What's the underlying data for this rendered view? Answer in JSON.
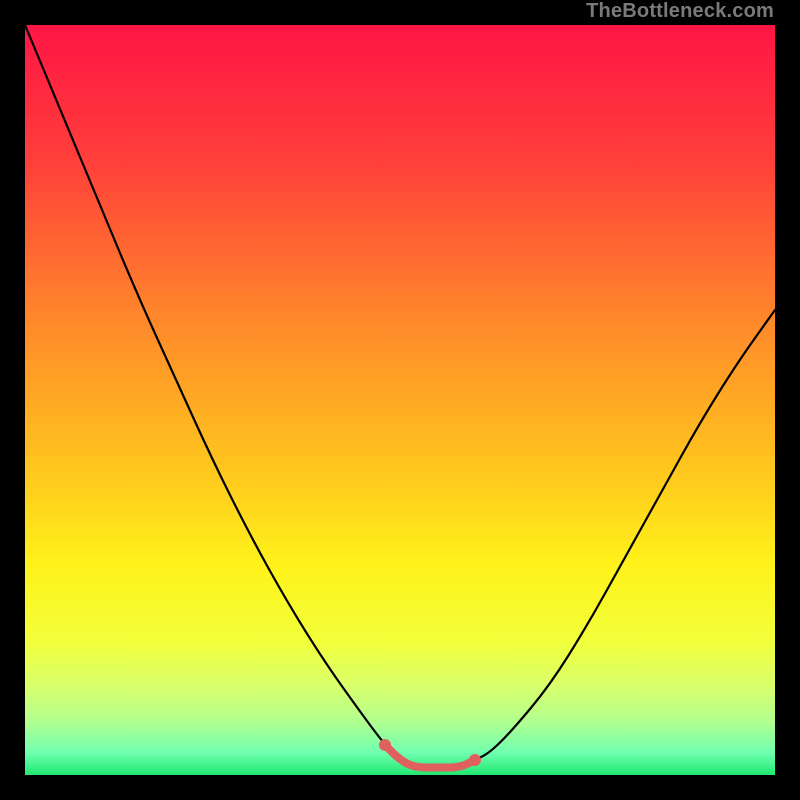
{
  "watermark": "TheBottleneck.com",
  "chart_data": {
    "type": "line",
    "title": "",
    "xlabel": "",
    "ylabel": "",
    "xlim": [
      0,
      100
    ],
    "ylim": [
      0,
      100
    ],
    "gradient_stops": [
      {
        "offset": 0,
        "color": "#ff1545"
      },
      {
        "offset": 18,
        "color": "#ff3f3a"
      },
      {
        "offset": 40,
        "color": "#ff8a2a"
      },
      {
        "offset": 58,
        "color": "#ffc21e"
      },
      {
        "offset": 72,
        "color": "#fff21a"
      },
      {
        "offset": 82,
        "color": "#f2ff3a"
      },
      {
        "offset": 88,
        "color": "#d9ff6a"
      },
      {
        "offset": 93,
        "color": "#b0ff90"
      },
      {
        "offset": 97,
        "color": "#70ffb0"
      },
      {
        "offset": 100,
        "color": "#20e870"
      }
    ],
    "series": [
      {
        "name": "bottleneck-curve",
        "color": "#000000",
        "x": [
          0,
          5,
          10,
          15,
          20,
          25,
          30,
          35,
          40,
          45,
          48,
          50,
          52,
          55,
          58,
          60,
          62,
          65,
          70,
          75,
          80,
          85,
          90,
          95,
          100
        ],
        "y": [
          100,
          88,
          76,
          64,
          53,
          42,
          32,
          23,
          15,
          8,
          4,
          2,
          1,
          1,
          1,
          2,
          3,
          6,
          12,
          20,
          29,
          38,
          47,
          55,
          62
        ]
      },
      {
        "name": "highlight-band",
        "color": "#e0605e",
        "x": [
          48,
          50,
          52,
          55,
          58,
          60
        ],
        "y": [
          4,
          2,
          1,
          1,
          1,
          2
        ]
      }
    ],
    "highlight_endpoints": {
      "x": [
        48,
        60
      ],
      "y": [
        4,
        2
      ],
      "color": "#e0605e"
    }
  }
}
